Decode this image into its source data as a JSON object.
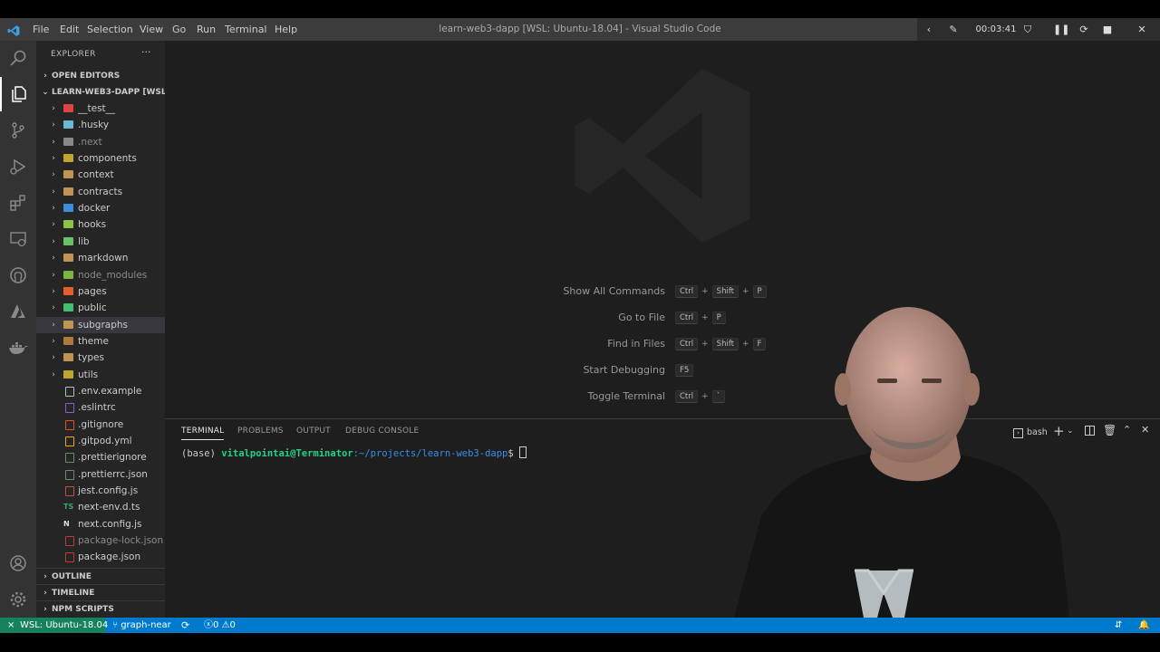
{
  "window": {
    "title": "learn-web3-dapp [WSL: Ubuntu-18.04] - Visual Studio Code",
    "menu": [
      "File",
      "Edit",
      "Selection",
      "View",
      "Go",
      "Run",
      "Terminal",
      "Help"
    ]
  },
  "recorder": {
    "timer": "00:03:41"
  },
  "activity_bar": {
    "icons": [
      "explorer-icon",
      "search-icon",
      "source-control-icon",
      "run-debug-icon",
      "extensions-icon",
      "remote-explorer-icon",
      "github-icon",
      "azure-icon",
      "docker-icon",
      "accounts-icon",
      "settings-gear-icon"
    ]
  },
  "sidebar": {
    "header": "EXPLORER",
    "more": "···",
    "open_editors": "OPEN EDITORS",
    "root": "LEARN-WEB3-DAPP [WSL: ...",
    "items": [
      {
        "name": "__test__",
        "folder": true,
        "color": "#e04343"
      },
      {
        "name": ".husky",
        "folder": true,
        "color": "#6bb7d6"
      },
      {
        "name": ".next",
        "folder": true,
        "color": "#888888",
        "dim": true
      },
      {
        "name": "components",
        "folder": true,
        "color": "#c0a52e"
      },
      {
        "name": "context",
        "folder": true,
        "color": "#c09553"
      },
      {
        "name": "contracts",
        "folder": true,
        "color": "#c09553"
      },
      {
        "name": "docker",
        "folder": true,
        "color": "#3c8fd6"
      },
      {
        "name": "hooks",
        "folder": true,
        "color": "#8bc34a"
      },
      {
        "name": "lib",
        "folder": true,
        "color": "#6abf69"
      },
      {
        "name": "markdown",
        "folder": true,
        "color": "#c09553"
      },
      {
        "name": "node_modules",
        "folder": true,
        "color": "#7cb342",
        "dim": true
      },
      {
        "name": "pages",
        "folder": true,
        "color": "#e65c2b"
      },
      {
        "name": "public",
        "folder": true,
        "color": "#3fbf6f"
      },
      {
        "name": "subgraphs",
        "folder": true,
        "color": "#c09553",
        "selected": true
      },
      {
        "name": "theme",
        "folder": true,
        "color": "#b07a3c"
      },
      {
        "name": "types",
        "folder": true,
        "color": "#c09553"
      },
      {
        "name": "utils",
        "folder": true,
        "color": "#c0a52e"
      },
      {
        "name": ".env.example",
        "folder": false,
        "color": "#bbbbbb"
      },
      {
        "name": ".eslintrc",
        "folder": false,
        "color": "#8e5dd6"
      },
      {
        "name": ".gitignore",
        "folder": false,
        "color": "#e0502c"
      },
      {
        "name": ".gitpod.yml",
        "folder": false,
        "color": "#f0a030"
      },
      {
        "name": ".prettierignore",
        "folder": false,
        "color": "#6d8a6d"
      },
      {
        "name": ".prettierrc.json",
        "folder": false,
        "color": "#6d8a6d"
      },
      {
        "name": "jest.config.js",
        "folder": false,
        "color": "#c94f3d"
      },
      {
        "name": "next-env.d.ts",
        "folder": false,
        "color": "#3aa675",
        "badge": "TS"
      },
      {
        "name": "next.config.js",
        "folder": false,
        "color": "#dddddd",
        "badge": "N"
      },
      {
        "name": "package-lock.json",
        "folder": false,
        "color": "#c03a3a",
        "dim": true
      },
      {
        "name": "package.json",
        "folder": false,
        "color": "#c03a3a"
      }
    ],
    "outline": "OUTLINE",
    "timeline": "TIMELINE",
    "npm_scripts": "NPM SCRIPTS"
  },
  "editor": {
    "shortcuts": [
      {
        "label": "Show All Commands",
        "keys": [
          "Ctrl",
          "Shift",
          "P"
        ]
      },
      {
        "label": "Go to File",
        "keys": [
          "Ctrl",
          "P"
        ]
      },
      {
        "label": "Find in Files",
        "keys": [
          "Ctrl",
          "Shift",
          "F"
        ]
      },
      {
        "label": "Start Debugging",
        "keys": [
          "F5"
        ]
      },
      {
        "label": "Toggle Terminal",
        "keys": [
          "Ctrl",
          "`"
        ]
      }
    ]
  },
  "panel": {
    "tabs": [
      "TERMINAL",
      "PROBLEMS",
      "OUTPUT",
      "DEBUG CONSOLE"
    ],
    "shell": "bash",
    "prompt_env": "(base) ",
    "prompt_user": "vitalpointai@Terminator",
    "prompt_path": ":~/projects/learn-web3-dapp",
    "prompt_sym": "$ "
  },
  "status": {
    "remote": "WSL: Ubuntu-18.04",
    "branch": "graph-near",
    "errors": "0",
    "warnings": "0"
  },
  "colors": {
    "status_bar": "#007acc",
    "remote": "#16825d",
    "prompt_user": "#23d18b",
    "prompt_path": "#3b8eea"
  }
}
